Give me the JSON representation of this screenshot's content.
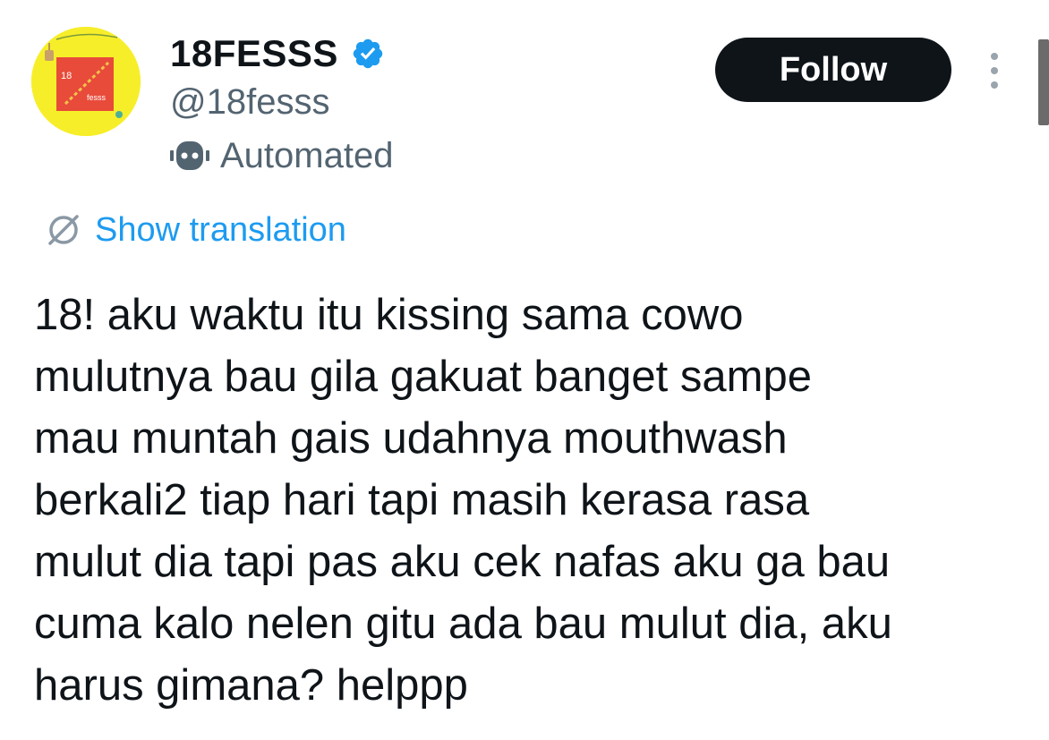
{
  "author": {
    "display_name": "18FESSS",
    "handle": "@18fesss",
    "label": "Automated",
    "avatar": {
      "background": "#f7ee2a",
      "inner_square": "#e84b3a",
      "text_top": "18",
      "text_bottom": "fesss"
    }
  },
  "actions": {
    "follow_label": "Follow",
    "more_icon": "more-vertical-icon"
  },
  "translation": {
    "link_label": "Show translation",
    "icon": "globe-icon"
  },
  "tweet": {
    "lines": [
      "18! aku waktu itu kissing sama cowo",
      "mulutnya bau gila gakuat banget sampe",
      "mau muntah gais udahnya mouthwash",
      "berkali2 tiap hari tapi masih kerasa rasa",
      "mulut dia tapi pas aku cek nafas aku ga bau",
      "cuma kalo nelen gitu ada bau mulut dia, aku",
      "harus gimana? helppp"
    ]
  },
  "colors": {
    "text_primary": "#0f1419",
    "text_secondary": "#536471",
    "link": "#1d9bf0",
    "verified": "#1d9bf0",
    "follow_bg": "#0f1419"
  }
}
